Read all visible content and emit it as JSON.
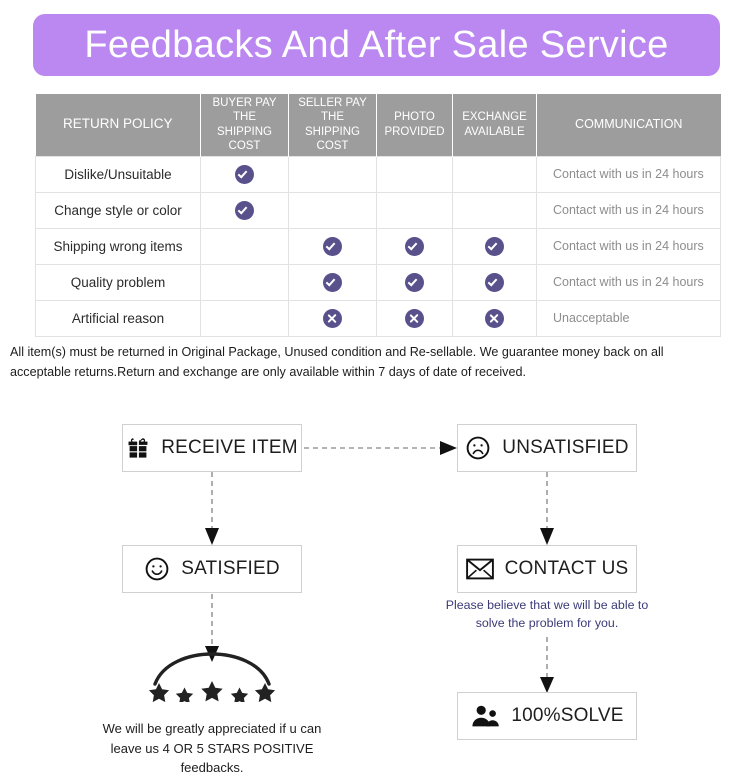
{
  "banner": {
    "title": "Feedbacks And After Sale Service",
    "background_color": "#bb87f0",
    "text_color": "#ffffff"
  },
  "table": {
    "header_background": "#9d9d9d",
    "badge_color": "#58518c",
    "columns": [
      "RETURN POLICY",
      "BUYER PAY THE SHIPPING COST",
      "SELLER PAY THE SHIPPING COST",
      "PHOTO PROVIDED",
      "EXCHANGE AVAILABLE",
      "COMMUNICATION"
    ],
    "rows": [
      {
        "reason": "Dislike/Unsuitable",
        "buyer_pay": "check",
        "seller_pay": "",
        "photo_provided": "",
        "exchange_available": "",
        "communication": "Contact with us in 24 hours"
      },
      {
        "reason": "Change style or color",
        "buyer_pay": "check",
        "seller_pay": "",
        "photo_provided": "",
        "exchange_available": "",
        "communication": "Contact with us in 24 hours"
      },
      {
        "reason": "Shipping wrong items",
        "buyer_pay": "",
        "seller_pay": "check",
        "photo_provided": "check",
        "exchange_available": "check",
        "communication": "Contact with us in 24 hours"
      },
      {
        "reason": "Quality problem",
        "buyer_pay": "",
        "seller_pay": "check",
        "photo_provided": "check",
        "exchange_available": "check",
        "communication": "Contact with us in 24 hours"
      },
      {
        "reason": "Artificial reason",
        "buyer_pay": "",
        "seller_pay": "cross",
        "photo_provided": "cross",
        "exchange_available": "cross",
        "communication": "Unacceptable"
      }
    ]
  },
  "disclaimer": "All item(s) must be returned in Original Package, Unused condition and Re-sellable. We guarantee money back on all acceptable returns.Return and exchange are only available within 7 days of date of received.",
  "flowchart": {
    "boxes": {
      "receive_item": {
        "label": "RECEIVE ITEM",
        "icon": "gift-icon"
      },
      "unsatisfied": {
        "label": "UNSATISFIED",
        "icon": "sad-face-icon"
      },
      "satisfied": {
        "label": "SATISFIED",
        "icon": "smiley-face-icon"
      },
      "contact_us": {
        "label": "CONTACT US",
        "icon": "envelope-icon"
      },
      "solve": {
        "label": "100%SOLVE",
        "icon": "people-icon"
      }
    },
    "contact_note": "Please believe that we will be able to solve the problem for you.",
    "contact_note_color": "#3b3b7a",
    "stars_note": "We will be greatly appreciated if u can leave us 4 OR 5 STARS POSITIVE feedbacks.",
    "star_count": 5
  }
}
